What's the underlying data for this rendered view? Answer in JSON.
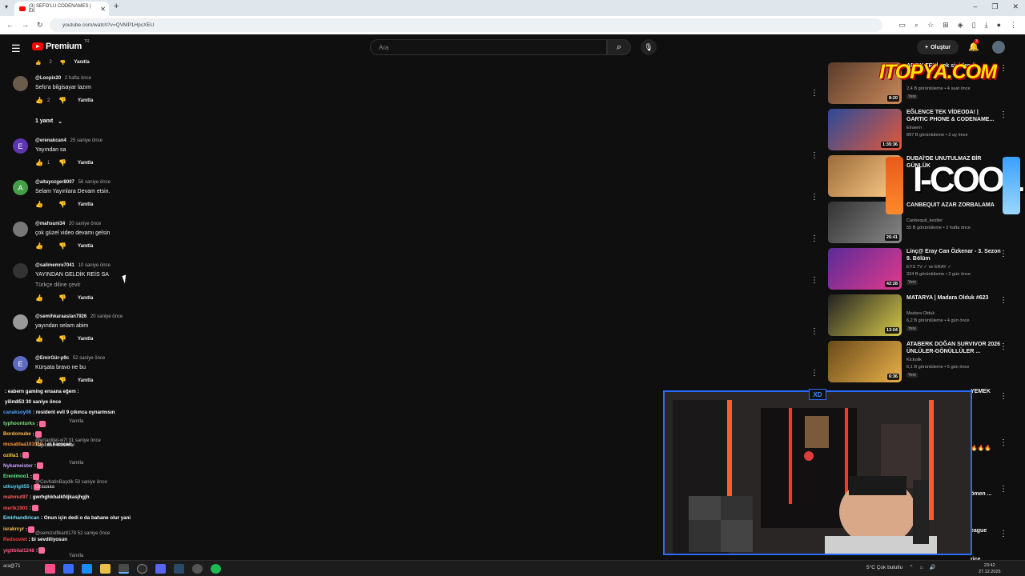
{
  "browser": {
    "tab_title": "(3) SEFO'LU CODENAMES | EK",
    "url": "youtube.com/watch?v=QVMP1HpcXEU"
  },
  "header": {
    "logo_text": "Premium",
    "logo_region": "TR",
    "search_placeholder": "Ara",
    "create_label": "Oluştur",
    "notif_count": "3"
  },
  "comments_top": {
    "likes": "2",
    "reply": "Yanıtla"
  },
  "replies_toggle": "1 yanıt",
  "comments": [
    {
      "user": "@Loopix20",
      "time": "2 hafta önce",
      "text": "Sefo'a bilgisayar lazım",
      "text2": "",
      "likes": "2",
      "reply": "Yanıtla",
      "avatar": "",
      "color": "#6b5b4b"
    },
    {
      "user": "@erenakcan4",
      "time": "25 saniye önce",
      "text": "Yayından sa",
      "text2": "",
      "likes": "1",
      "reply": "Yanıtla",
      "avatar": "E",
      "color": "#5e35b1"
    },
    {
      "user": "@altayozger8007",
      "time": "56 saniye önce",
      "text": "Selam Yayınlara Devam etsin.",
      "text2": "",
      "likes": "",
      "reply": "Yanıtla",
      "avatar": "A",
      "color": "#43a047"
    },
    {
      "user": "@mahsuni34",
      "time": "20 saniye önce",
      "text": "çok güzel video devamı gelsin",
      "text2": "",
      "likes": "",
      "reply": "Yanıtla",
      "avatar": "",
      "color": "#777"
    },
    {
      "user": "@salimemre7041",
      "time": "10 saniye önce",
      "text": "YAYINDAN GELDİK REİS SA",
      "text2": "Türkçe diline çevir",
      "likes": "",
      "reply": "Yanıtla",
      "avatar": "",
      "color": "#333"
    },
    {
      "user": "@semihkaraaslan7926",
      "time": "20 saniye önce",
      "text": "yayından selam abim",
      "text2": "",
      "likes": "",
      "reply": "Yanıtla",
      "avatar": "",
      "color": "#999"
    },
    {
      "user": "@EmirGür-p9c",
      "time": "52 saniye önce",
      "text": "Kürşata bravo ne bu",
      "text2": "",
      "likes": "",
      "reply": "Yanıtla",
      "avatar": "E",
      "color": "#5c6bc0"
    }
  ],
  "chat": [
    {
      "user": "",
      "msg": ": eabern gaming ensana eğem :",
      "color": "#fff"
    },
    {
      "user": "",
      "msg": "yilim853  30 saniye önce",
      "color": "#aaa"
    },
    {
      "user": "canaksoy06",
      "msg": ": resident evil 9 çıkınca oynarmısın",
      "color": "#4da3ff"
    },
    {
      "user": "typhoonturks",
      "msg": ":",
      "color": "#7fe07f"
    },
    {
      "user": "Bordomube",
      "msg": ":",
      "color": "#ffb84d"
    },
    {
      "user": "musablaa101010",
      "msg": ": ei karocan",
      "color": "#ff9a3d"
    },
    {
      "user": "ozilla1",
      "msg": ":",
      "color": "#ffd23d"
    },
    {
      "user": "Nykameister",
      "msg": ":",
      "color": "#c9a3ff"
    },
    {
      "user": "Erenimoo1",
      "msg": ":",
      "color": "#5cf08a"
    },
    {
      "user": "utkuyigit55",
      "msg": ":",
      "color": "#5cd0f0"
    },
    {
      "user": "mahmut97",
      "msg": ": gwrhghkhalkfdjkasjhgjh",
      "color": "#ff5c5c"
    },
    {
      "user": "mertk1903",
      "msg": ":",
      "color": "#ff4d4d"
    },
    {
      "user": "Emirhandirican",
      "msg": ": Onun için dedi o da bahane olur yani",
      "color": "#7fe0ff"
    },
    {
      "user": "israkrcyr",
      "msg": ":",
      "color": "#ffc14d"
    },
    {
      "user": "Redsoviet",
      "msg": ": bi sevdiliyosun",
      "color": "#ff3d3d"
    },
    {
      "user": "yigitbilal1248",
      "msg": ":",
      "color": "#ff5c8a"
    }
  ],
  "under_comments": [
    {
      "user": "@ertanlitel-w7l",
      "time": "31 saniye önce",
      "text": "Yayından selamlar"
    },
    {
      "user": "@CevhatinBaşdik",
      "time": "53 saniye önce",
      "text": "Uzaaaaa"
    },
    {
      "user": "@semizulfikar8178",
      "time": "52 saniye önce",
      "text": ""
    }
  ],
  "sidebar": [
    {
      "title": "ARTIK TENİ çok sinirlendi...",
      "channel": "",
      "views": "2,4 B görüntüleme • 4 saat önce",
      "new": "Yeni",
      "dur": "8:20",
      "c1": "#5a3b2b",
      "c2": "#c98a5a"
    },
    {
      "title": "EĞLENCE TEK VİDEODA! | GARTIC PHONE & CODENAME...",
      "channel": "Elraenn",
      "views": "897 B görüntüleme • 2 ay önce",
      "new": "",
      "dur": "1:35:36",
      "c1": "#2b4a9a",
      "c2": "#e05a3a"
    },
    {
      "title": "DUBAİ'DE UNUTULMAZ BİR GÜNLÜK",
      "channel": "",
      "views": "",
      "new": "",
      "dur": "",
      "c1": "#9a6a3a",
      "c2": "#ffcf8a"
    },
    {
      "title": "CANBEQUIT AZAR ZORBALAMA",
      "channel": "Canbequit_kestler",
      "views": "55 B görüntüleme • 2 hafta önce",
      "new": "",
      "dur": "26:41",
      "c1": "#333",
      "c2": "#888"
    },
    {
      "title": "Linç@ Eray Can Özkenar - 3. Sezon 9. Bölüm",
      "channel": "EYS TV ✓ ve ERAY ✓",
      "views": "324 B görüntüleme • 2 gün önce",
      "new": "Yeni",
      "dur": "42:28",
      "c1": "#5b2b9a",
      "c2": "#e03a8a"
    },
    {
      "title": "MATARYA | Madara Olduk #623",
      "channel": "Madara Olduk",
      "views": "6,2 B görüntüleme • 4 gün önce",
      "new": "Yeni",
      "dur": "13:04",
      "c1": "#222",
      "c2": "#d4c84a"
    },
    {
      "title": "ATABERK DOĞAN SURVIVOR 2026 ÜNLÜLER-GÖNÜLLÜLER ...",
      "channel": "Kickolik",
      "views": "6,1 B görüntüleme • 5 gün önce",
      "new": "Yeni",
      "dur": "6:36",
      "c1": "#6a4a1a",
      "c2": "#e8b04a"
    }
  ],
  "sidebar_partial": [
    "YEMEK",
    "🔥🔥🔥",
    "ömen ...",
    "eague",
    "rice"
  ],
  "overlays": {
    "watermark": "ITOPYA.COM",
    "drink": "I-COOL"
  },
  "taskbar": {
    "search": "ara@71",
    "weather": "5°C  Çok bulutlu",
    "time": "23:42",
    "date": "27.12.2025"
  }
}
